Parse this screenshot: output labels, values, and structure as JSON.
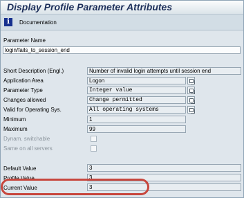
{
  "window": {
    "title": "Display Profile Parameter Attributes"
  },
  "toolbar": {
    "documentation_label": "Documentation"
  },
  "form": {
    "parameter_name_label": "Parameter Name",
    "parameter_name_value": "login/fails_to_session_end",
    "short_description_label": "Short Description (Engl.)",
    "short_description_value": "Number of invalid login attempts until session end",
    "application_area_label": "Application Area",
    "application_area_value": "Logon",
    "parameter_type_label": "Parameter Type",
    "parameter_type_value": "Integer value",
    "changes_allowed_label": "Changes allowed",
    "changes_allowed_value": "Change permitted",
    "valid_for_os_label": "Valid for Operating Sys.",
    "valid_for_os_value": "All operating systems",
    "minimum_label": "Minimum",
    "minimum_value": "1",
    "maximum_label": "Maximum",
    "maximum_value": "99",
    "dynam_switchable_label": "Dynam. switchable",
    "same_on_all_servers_label": "Same on all servers",
    "default_value_label": "Default Value",
    "default_value_value": "3",
    "profile_value_label": "Profile Value",
    "profile_value_value": "3",
    "current_value_label": "Current Value",
    "current_value_value": "3"
  },
  "colors": {
    "title": "#1d2f5a",
    "highlight": "#c7463d"
  }
}
